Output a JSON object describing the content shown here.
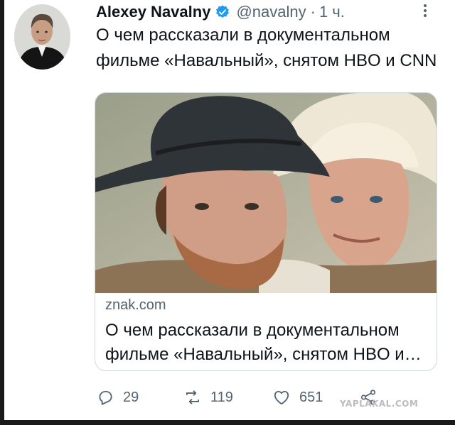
{
  "tweet": {
    "author_name": "Alexey Navalny",
    "handle": "@navalny",
    "separator": "·",
    "time": "1 ч.",
    "text": "О чем рассказали в документальном фильме «Навальный», снятом HBO и CNN",
    "verified": true,
    "accent_color": "#1d9bf0"
  },
  "card": {
    "domain": "znak.com",
    "title": "О чем рассказали в документальном фильме «Навальный», снятом HBO и CNN",
    "image_alt": "Two men wearing cowboy hats, photo collage"
  },
  "actions": {
    "reply_count": "29",
    "retweet_count": "119",
    "like_count": "651",
    "icons": [
      "reply-icon",
      "retweet-icon",
      "like-icon",
      "share-icon"
    ]
  },
  "watermark": "YAPLAKAL.COM"
}
